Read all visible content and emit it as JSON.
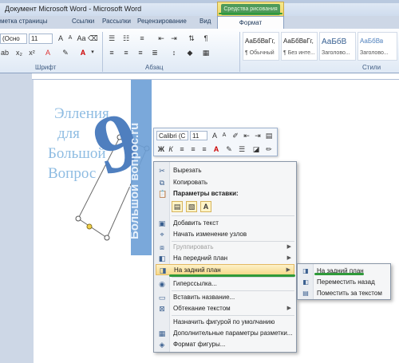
{
  "window": {
    "title": "Документ Microsoft Word  -  Microsoft Word",
    "contextual_tab_group": "Средства рисования"
  },
  "tabs": [
    "метка страницы",
    "Ссылки",
    "Рассылки",
    "Рецензирование",
    "Вид",
    "Формат"
  ],
  "ribbon": {
    "font_name": "(Осно",
    "font_size": "11",
    "groups": {
      "font": "Шрифт",
      "paragraph": "Абзац",
      "styles": "Стили"
    },
    "styles": [
      {
        "sample": "АаБбВвГг,",
        "label": "¶ Обычный"
      },
      {
        "sample": "АаБбВвГг,",
        "label": "¶ Без инте..."
      },
      {
        "sample": "АаБбВ",
        "label": "Заголово..."
      },
      {
        "sample": "АаБбВв",
        "label": "Заголово..."
      }
    ]
  },
  "document": {
    "text_lines": [
      "Элления",
      "для",
      "Большой",
      "Вопрос"
    ],
    "big_glyph": "9",
    "watermark": "Большой вопрос.ru"
  },
  "mini_toolbar": {
    "font_name": "Calibri (С",
    "font_size": "11"
  },
  "context_menu": {
    "items": {
      "cut": "Вырезать",
      "copy": "Копировать",
      "paste_options": "Параметры вставки:",
      "add_text": "Добавить текст",
      "edit_points": "Начать изменение узлов",
      "group": "Группировать",
      "bring_front": "На передний план",
      "send_back": "На задний план",
      "hyperlink": "Гиперссылка...",
      "insert_caption": "Вставить название...",
      "text_wrap": "Обтекание текстом",
      "set_default": "Назначить фигурой по умолчанию",
      "more_layout": "Дополнительные параметры разметки...",
      "format_shape": "Формат фигуры..."
    }
  },
  "submenu": {
    "items": [
      "На задний план",
      "Переместить назад",
      "Поместить за текстом"
    ]
  },
  "colors": {
    "highlight": "#f6d98a",
    "annotation_green": "#2f9a3a",
    "shape_blue": "#4f7fbf",
    "text_light_blue": "#8ebce2"
  }
}
